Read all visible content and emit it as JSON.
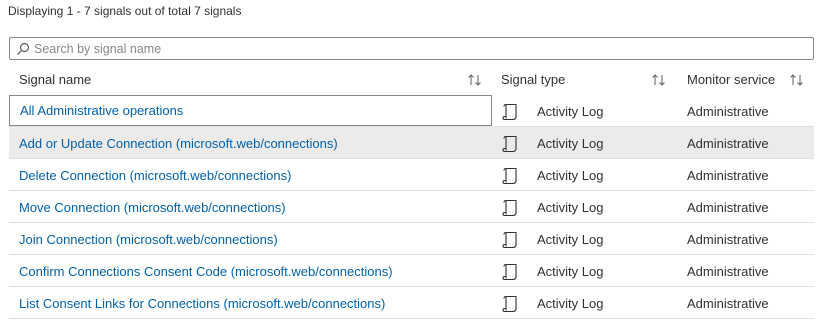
{
  "summary": "Displaying 1 - 7 signals out of total 7 signals",
  "search": {
    "placeholder": "Search by signal name",
    "value": ""
  },
  "columns": {
    "signal_name": "Signal name",
    "signal_type": "Signal type",
    "monitor_service": "Monitor service"
  },
  "icons": {
    "search": "search-icon",
    "sort": "sort-arrows-icon",
    "signal_type": "activity-log-scroll-icon"
  },
  "colors": {
    "link": "#0062ad",
    "highlight": "#edebe9",
    "border": "#8a8886"
  },
  "rows": [
    {
      "name": "All Administrative operations",
      "type": "Activity Log",
      "monitor": "Administrative"
    },
    {
      "name": "Add or Update Connection (microsoft.web/connections)",
      "type": "Activity Log",
      "monitor": "Administrative"
    },
    {
      "name": "Delete Connection (microsoft.web/connections)",
      "type": "Activity Log",
      "monitor": "Administrative"
    },
    {
      "name": "Move Connection (microsoft.web/connections)",
      "type": "Activity Log",
      "monitor": "Administrative"
    },
    {
      "name": "Join Connection (microsoft.web/connections)",
      "type": "Activity Log",
      "monitor": "Administrative"
    },
    {
      "name": "Confirm Connections Consent Code (microsoft.web/connections)",
      "type": "Activity Log",
      "monitor": "Administrative"
    },
    {
      "name": "List Consent Links for Connections (microsoft.web/connections)",
      "type": "Activity Log",
      "monitor": "Administrative"
    }
  ]
}
